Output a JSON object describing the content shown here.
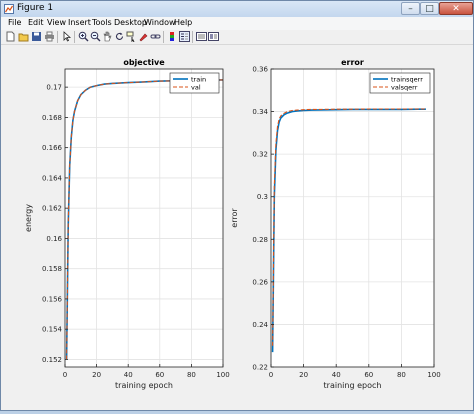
{
  "window": {
    "title": "Figure 1",
    "buttons": {
      "minimize": "–",
      "maximize": "□",
      "close": "✕"
    }
  },
  "menu": [
    "File",
    "Edit",
    "View",
    "Insert",
    "Tools",
    "Desktop",
    "Window",
    "Help"
  ],
  "toolbar": [
    "new-figure-icon",
    "open-file-icon",
    "save-icon",
    "print-icon",
    "pointer-icon",
    "zoom-in-icon",
    "zoom-out-icon",
    "pan-icon",
    "rotate-icon",
    "data-cursor-icon",
    "brush-icon",
    "link-icon",
    "colorbar-icon",
    "legend-icon",
    "hide-plot-tools-icon",
    "show-plot-tools-icon"
  ],
  "colors": {
    "train": "#0072bd",
    "val": "#d95319"
  },
  "chart_data": [
    {
      "type": "line",
      "title": "objective",
      "xlabel": "training epoch",
      "ylabel": "energy",
      "xlim": [
        0,
        100
      ],
      "ylim": [
        0.1515,
        0.1712
      ],
      "xticks": [
        0,
        20,
        40,
        60,
        80,
        100
      ],
      "yticks": [
        0.152,
        0.154,
        0.156,
        0.158,
        0.16,
        0.162,
        0.164,
        0.166,
        0.168,
        0.17
      ],
      "ytick_labels": [
        "0.152",
        "0.154",
        "0.156",
        "0.158",
        "0.16",
        "0.162",
        "0.164",
        "0.166",
        "0.168",
        "0.17"
      ],
      "grid": true,
      "legend_position": "top-right",
      "series": [
        {
          "name": "train",
          "style": "solid",
          "color": "#0072bd",
          "x": [
            1,
            2,
            3,
            4,
            5,
            6,
            8,
            10,
            13,
            16,
            20,
            25,
            30,
            40,
            50,
            60,
            70,
            80,
            90,
            100
          ],
          "y": [
            0.152,
            0.1608,
            0.1648,
            0.1667,
            0.1678,
            0.1684,
            0.1691,
            0.1695,
            0.1698,
            0.17,
            0.1701,
            0.1702,
            0.17025,
            0.1703,
            0.17035,
            0.1704,
            0.17042,
            0.17044,
            0.17046,
            0.17048
          ]
        },
        {
          "name": "val",
          "style": "dashed",
          "color": "#d95319",
          "x": [
            1,
            2,
            3,
            4,
            5,
            6,
            8,
            10,
            13,
            16,
            20,
            25,
            30,
            40,
            50,
            60,
            70,
            80,
            90,
            100
          ],
          "y": [
            0.152,
            0.1608,
            0.1648,
            0.1667,
            0.1678,
            0.1684,
            0.1691,
            0.1695,
            0.1698,
            0.17,
            0.1701,
            0.1702,
            0.17025,
            0.1703,
            0.17035,
            0.1704,
            0.17042,
            0.17044,
            0.17046,
            0.17048
          ]
        }
      ]
    },
    {
      "type": "line",
      "title": "error",
      "xlabel": "training epoch",
      "ylabel": "error",
      "xlim": [
        0,
        100
      ],
      "ylim": [
        0.22,
        0.36
      ],
      "xticks": [
        0,
        20,
        40,
        60,
        80,
        100
      ],
      "yticks": [
        0.22,
        0.24,
        0.26,
        0.28,
        0.3,
        0.32,
        0.34,
        0.36
      ],
      "ytick_labels": [
        "0.22",
        "0.24",
        "0.26",
        "0.28",
        "0.3",
        "0.32",
        "0.34",
        "0.36"
      ],
      "grid": true,
      "legend_position": "top-right",
      "series": [
        {
          "name": "trainsqerr",
          "style": "solid",
          "color": "#0072bd",
          "x": [
            1,
            2,
            3,
            4,
            5,
            6,
            8,
            10,
            13,
            16,
            20,
            25,
            30,
            40,
            50,
            60,
            70,
            80,
            90,
            95
          ],
          "y": [
            0.227,
            0.3,
            0.322,
            0.331,
            0.335,
            0.337,
            0.3385,
            0.3393,
            0.34,
            0.3403,
            0.3405,
            0.3407,
            0.3408,
            0.3409,
            0.341,
            0.341,
            0.341,
            0.341,
            0.3411,
            0.3411
          ]
        },
        {
          "name": "valsqerr",
          "style": "dashed",
          "color": "#d95319",
          "x": [
            1,
            2,
            3,
            4,
            5,
            6,
            8,
            10,
            13,
            16,
            20,
            25,
            30,
            40,
            50,
            60,
            70,
            80,
            90,
            95
          ],
          "y": [
            0.23,
            0.305,
            0.325,
            0.333,
            0.3365,
            0.338,
            0.3392,
            0.34,
            0.3405,
            0.3407,
            0.3409,
            0.341,
            0.341,
            0.3411,
            0.3411,
            0.3412,
            0.3412,
            0.3412,
            0.3412,
            0.3412
          ]
        }
      ]
    }
  ]
}
